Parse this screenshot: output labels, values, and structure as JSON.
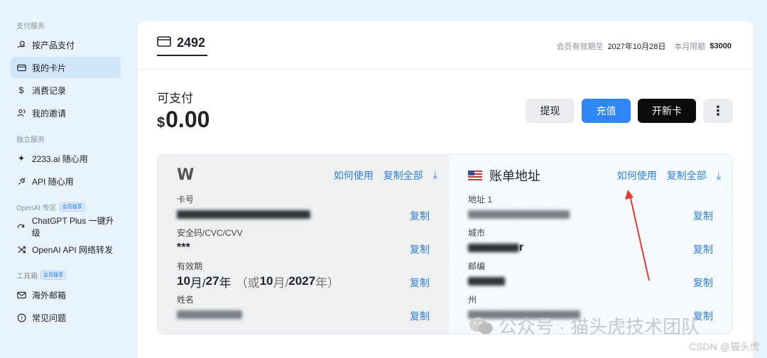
{
  "sidebar": {
    "sections": [
      {
        "title": "支付服务",
        "badge": "",
        "items": [
          {
            "label": "按产品支付",
            "icon": "coin-hand-icon",
            "active": false
          },
          {
            "label": "我的卡片",
            "icon": "card-icon",
            "active": true
          },
          {
            "label": "消费记录",
            "icon": "dollar-icon",
            "active": false
          },
          {
            "label": "我的邀请",
            "icon": "users-icon",
            "active": false
          }
        ]
      },
      {
        "title": "独立服务",
        "badge": "",
        "items": [
          {
            "label": "2233.ai 随心用",
            "icon": "sparkle-icon",
            "active": false
          },
          {
            "label": "API 随心用",
            "icon": "plug-icon",
            "active": false
          }
        ]
      },
      {
        "title": "OpenAI 专区",
        "badge": "会员独享",
        "items": [
          {
            "label": "ChatGPT Plus 一键升级",
            "icon": "upgrade-icon",
            "active": false
          },
          {
            "label": "OpenAI API 网络转发",
            "icon": "shuffle-icon",
            "active": false
          }
        ]
      },
      {
        "title": "工具箱",
        "badge": "会员独享",
        "items": [
          {
            "label": "海外邮箱",
            "icon": "mail-icon",
            "active": false
          },
          {
            "label": "常见问题",
            "icon": "question-icon",
            "active": false
          }
        ]
      }
    ]
  },
  "header": {
    "card_number": "2492",
    "membership_label": "会员有效期至",
    "membership_date": "2027年10月28日",
    "limit_label": "本月限额",
    "limit_value": "$3000"
  },
  "balance": {
    "label": "可支付",
    "currency": "$",
    "amount": "0.00"
  },
  "actions": {
    "withdraw": "提现",
    "recharge": "充值",
    "new_card": "开新卡",
    "more": "⋮"
  },
  "card_panel": {
    "brand": "W",
    "how_to_use": "如何使用",
    "copy_all": "复制全部",
    "fields": {
      "card_number_label": "卡号",
      "cvv_label": "安全码/CVC/CVV",
      "cvv_value": "***",
      "expiry_label": "有效期",
      "expiry_month": "10",
      "expiry_month_unit": "月/",
      "expiry_year": "27",
      "expiry_year_unit": "年",
      "expiry_full_open": "（或",
      "expiry_full_month": "10",
      "expiry_full_sep": "月/",
      "expiry_full_year": "2027",
      "expiry_full_close": "年）",
      "name_label": "姓名"
    },
    "copy_label": "复制"
  },
  "address_panel": {
    "title": "账单地址",
    "how_to_use": "如何使用",
    "copy_all": "复制全部",
    "fields": {
      "address_label": "地址 1",
      "city_label": "城市",
      "city_partial": "r",
      "zip_label": "邮编",
      "state_label": "州"
    },
    "copy_label": "复制"
  },
  "watermark": {
    "text": "公众号 · 猫头虎技术团队",
    "csdn": "CSDN @猫头虎"
  },
  "colors": {
    "accent": "#2f86f6",
    "link": "#2f7fd6",
    "active_nav": "#cfe6fb",
    "annotation_arrow": "#e53935"
  }
}
